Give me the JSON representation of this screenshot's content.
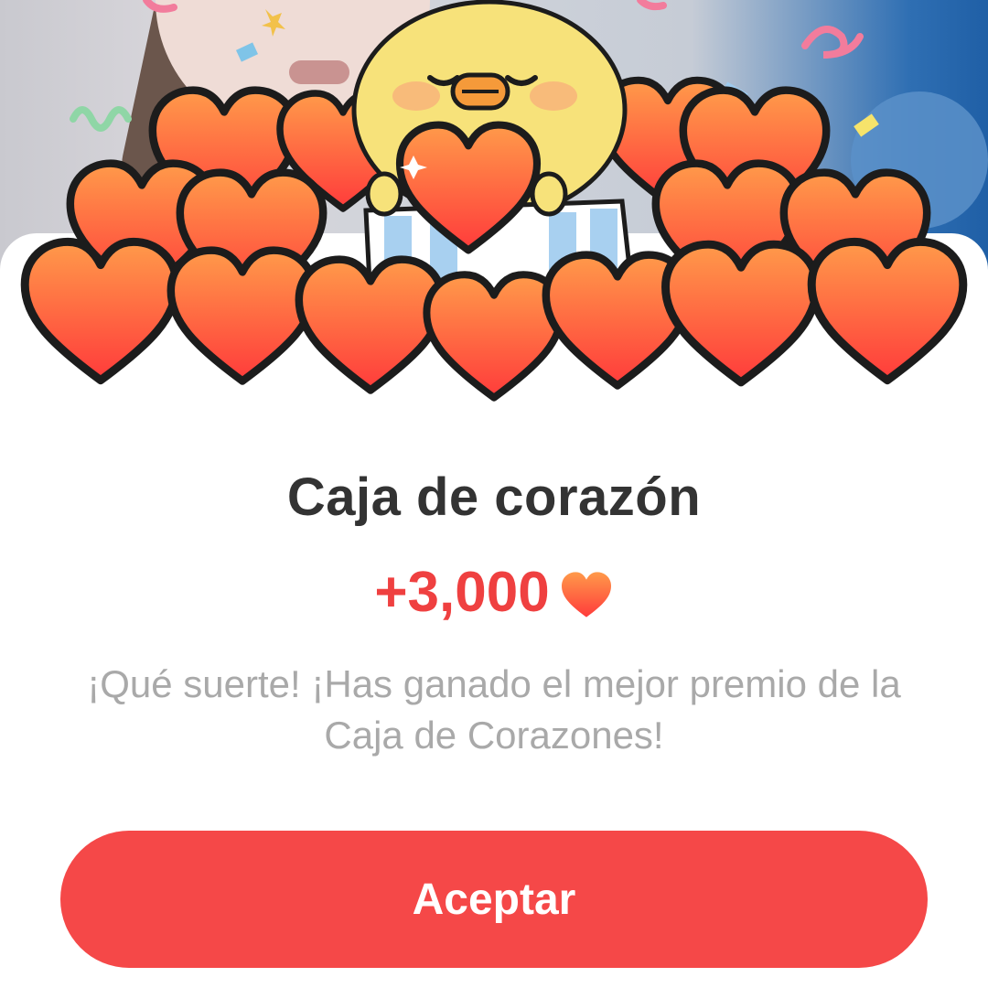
{
  "dialog": {
    "title": "Caja de corazón",
    "reward_amount": "+3,000",
    "reward_icon": "heart-icon",
    "message": "¡Qué suerte! ¡Has ganado el mejor premio de la Caja de Corazones!",
    "accept_label": "Aceptar"
  },
  "colors": {
    "accent": "#f54848",
    "reward_text": "#ef4040",
    "title_text": "#333333",
    "message_text": "#a9a9a9",
    "heart_top": "#ff9a4a",
    "heart_bottom": "#ff3b3b",
    "chick": "#f7e27a"
  }
}
